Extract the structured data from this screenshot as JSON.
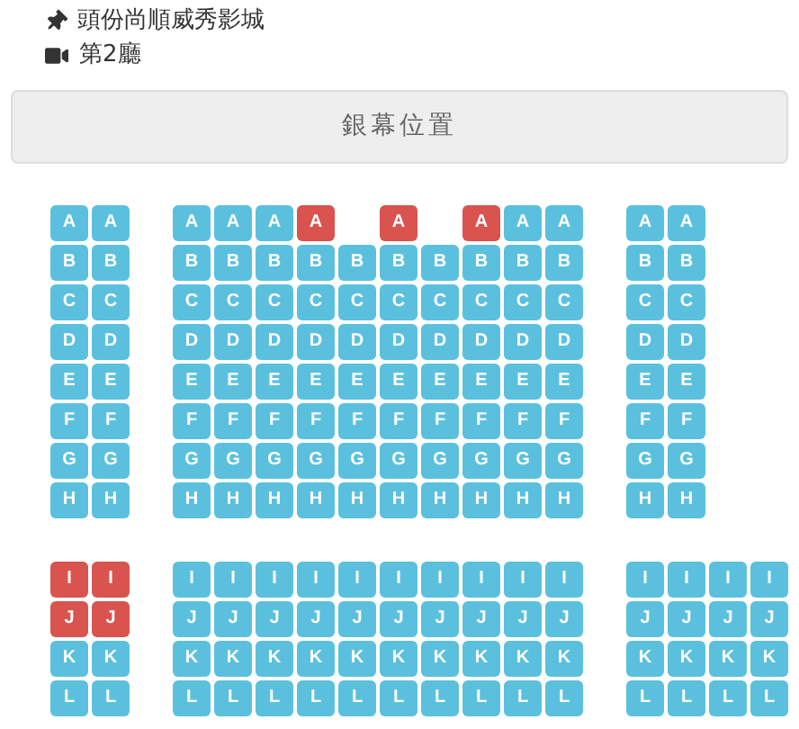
{
  "cinema": "頭份尚順威秀影城",
  "hall": "第2廳",
  "screen": {
    "label": "銀幕位置"
  },
  "sections": [
    {
      "rows": [
        {
          "blocks": [
            [
              {
                "kind": "seat",
                "label": "A",
                "taken": false
              },
              {
                "kind": "seat",
                "label": "A",
                "taken": false
              }
            ],
            [
              {
                "kind": "seat",
                "label": "A",
                "taken": false
              },
              {
                "kind": "seat",
                "label": "A",
                "taken": false
              },
              {
                "kind": "seat",
                "label": "A",
                "taken": false
              },
              {
                "kind": "seat",
                "label": "A",
                "taken": true
              },
              {
                "kind": "empty"
              },
              {
                "kind": "seat",
                "label": "A",
                "taken": true
              },
              {
                "kind": "empty"
              },
              {
                "kind": "seat",
                "label": "A",
                "taken": true
              },
              {
                "kind": "seat",
                "label": "A",
                "taken": false
              },
              {
                "kind": "seat",
                "label": "A",
                "taken": false
              }
            ],
            [
              {
                "kind": "seat",
                "label": "A",
                "taken": false
              },
              {
                "kind": "seat",
                "label": "A",
                "taken": false
              }
            ]
          ]
        },
        {
          "blocks": [
            [
              {
                "kind": "seat",
                "label": "B",
                "taken": false
              },
              {
                "kind": "seat",
                "label": "B",
                "taken": false
              }
            ],
            [
              {
                "kind": "seat",
                "label": "B",
                "taken": false
              },
              {
                "kind": "seat",
                "label": "B",
                "taken": false
              },
              {
                "kind": "seat",
                "label": "B",
                "taken": false
              },
              {
                "kind": "seat",
                "label": "B",
                "taken": false
              },
              {
                "kind": "seat",
                "label": "B",
                "taken": false
              },
              {
                "kind": "seat",
                "label": "B",
                "taken": false
              },
              {
                "kind": "seat",
                "label": "B",
                "taken": false
              },
              {
                "kind": "seat",
                "label": "B",
                "taken": false
              },
              {
                "kind": "seat",
                "label": "B",
                "taken": false
              },
              {
                "kind": "seat",
                "label": "B",
                "taken": false
              }
            ],
            [
              {
                "kind": "seat",
                "label": "B",
                "taken": false
              },
              {
                "kind": "seat",
                "label": "B",
                "taken": false
              }
            ]
          ]
        },
        {
          "blocks": [
            [
              {
                "kind": "seat",
                "label": "C",
                "taken": false
              },
              {
                "kind": "seat",
                "label": "C",
                "taken": false
              }
            ],
            [
              {
                "kind": "seat",
                "label": "C",
                "taken": false
              },
              {
                "kind": "seat",
                "label": "C",
                "taken": false
              },
              {
                "kind": "seat",
                "label": "C",
                "taken": false
              },
              {
                "kind": "seat",
                "label": "C",
                "taken": false
              },
              {
                "kind": "seat",
                "label": "C",
                "taken": false
              },
              {
                "kind": "seat",
                "label": "C",
                "taken": false
              },
              {
                "kind": "seat",
                "label": "C",
                "taken": false
              },
              {
                "kind": "seat",
                "label": "C",
                "taken": false
              },
              {
                "kind": "seat",
                "label": "C",
                "taken": false
              },
              {
                "kind": "seat",
                "label": "C",
                "taken": false
              }
            ],
            [
              {
                "kind": "seat",
                "label": "C",
                "taken": false
              },
              {
                "kind": "seat",
                "label": "C",
                "taken": false
              }
            ]
          ]
        },
        {
          "blocks": [
            [
              {
                "kind": "seat",
                "label": "D",
                "taken": false
              },
              {
                "kind": "seat",
                "label": "D",
                "taken": false
              }
            ],
            [
              {
                "kind": "seat",
                "label": "D",
                "taken": false
              },
              {
                "kind": "seat",
                "label": "D",
                "taken": false
              },
              {
                "kind": "seat",
                "label": "D",
                "taken": false
              },
              {
                "kind": "seat",
                "label": "D",
                "taken": false
              },
              {
                "kind": "seat",
                "label": "D",
                "taken": false
              },
              {
                "kind": "seat",
                "label": "D",
                "taken": false
              },
              {
                "kind": "seat",
                "label": "D",
                "taken": false
              },
              {
                "kind": "seat",
                "label": "D",
                "taken": false
              },
              {
                "kind": "seat",
                "label": "D",
                "taken": false
              },
              {
                "kind": "seat",
                "label": "D",
                "taken": false
              }
            ],
            [
              {
                "kind": "seat",
                "label": "D",
                "taken": false
              },
              {
                "kind": "seat",
                "label": "D",
                "taken": false
              }
            ]
          ]
        },
        {
          "blocks": [
            [
              {
                "kind": "seat",
                "label": "E",
                "taken": false
              },
              {
                "kind": "seat",
                "label": "E",
                "taken": false
              }
            ],
            [
              {
                "kind": "seat",
                "label": "E",
                "taken": false
              },
              {
                "kind": "seat",
                "label": "E",
                "taken": false
              },
              {
                "kind": "seat",
                "label": "E",
                "taken": false
              },
              {
                "kind": "seat",
                "label": "E",
                "taken": false
              },
              {
                "kind": "seat",
                "label": "E",
                "taken": false
              },
              {
                "kind": "seat",
                "label": "E",
                "taken": false
              },
              {
                "kind": "seat",
                "label": "E",
                "taken": false
              },
              {
                "kind": "seat",
                "label": "E",
                "taken": false
              },
              {
                "kind": "seat",
                "label": "E",
                "taken": false
              },
              {
                "kind": "seat",
                "label": "E",
                "taken": false
              }
            ],
            [
              {
                "kind": "seat",
                "label": "E",
                "taken": false
              },
              {
                "kind": "seat",
                "label": "E",
                "taken": false
              }
            ]
          ]
        },
        {
          "blocks": [
            [
              {
                "kind": "seat",
                "label": "F",
                "taken": false
              },
              {
                "kind": "seat",
                "label": "F",
                "taken": false
              }
            ],
            [
              {
                "kind": "seat",
                "label": "F",
                "taken": false
              },
              {
                "kind": "seat",
                "label": "F",
                "taken": false
              },
              {
                "kind": "seat",
                "label": "F",
                "taken": false
              },
              {
                "kind": "seat",
                "label": "F",
                "taken": false
              },
              {
                "kind": "seat",
                "label": "F",
                "taken": false
              },
              {
                "kind": "seat",
                "label": "F",
                "taken": false
              },
              {
                "kind": "seat",
                "label": "F",
                "taken": false
              },
              {
                "kind": "seat",
                "label": "F",
                "taken": false
              },
              {
                "kind": "seat",
                "label": "F",
                "taken": false
              },
              {
                "kind": "seat",
                "label": "F",
                "taken": false
              }
            ],
            [
              {
                "kind": "seat",
                "label": "F",
                "taken": false
              },
              {
                "kind": "seat",
                "label": "F",
                "taken": false
              }
            ]
          ]
        },
        {
          "blocks": [
            [
              {
                "kind": "seat",
                "label": "G",
                "taken": false
              },
              {
                "kind": "seat",
                "label": "G",
                "taken": false
              }
            ],
            [
              {
                "kind": "seat",
                "label": "G",
                "taken": false
              },
              {
                "kind": "seat",
                "label": "G",
                "taken": false
              },
              {
                "kind": "seat",
                "label": "G",
                "taken": false
              },
              {
                "kind": "seat",
                "label": "G",
                "taken": false
              },
              {
                "kind": "seat",
                "label": "G",
                "taken": false
              },
              {
                "kind": "seat",
                "label": "G",
                "taken": false
              },
              {
                "kind": "seat",
                "label": "G",
                "taken": false
              },
              {
                "kind": "seat",
                "label": "G",
                "taken": false
              },
              {
                "kind": "seat",
                "label": "G",
                "taken": false
              },
              {
                "kind": "seat",
                "label": "G",
                "taken": false
              }
            ],
            [
              {
                "kind": "seat",
                "label": "G",
                "taken": false
              },
              {
                "kind": "seat",
                "label": "G",
                "taken": false
              }
            ]
          ]
        },
        {
          "blocks": [
            [
              {
                "kind": "seat",
                "label": "H",
                "taken": false
              },
              {
                "kind": "seat",
                "label": "H",
                "taken": false
              }
            ],
            [
              {
                "kind": "seat",
                "label": "H",
                "taken": false
              },
              {
                "kind": "seat",
                "label": "H",
                "taken": false
              },
              {
                "kind": "seat",
                "label": "H",
                "taken": false
              },
              {
                "kind": "seat",
                "label": "H",
                "taken": false
              },
              {
                "kind": "seat",
                "label": "H",
                "taken": false
              },
              {
                "kind": "seat",
                "label": "H",
                "taken": false
              },
              {
                "kind": "seat",
                "label": "H",
                "taken": false
              },
              {
                "kind": "seat",
                "label": "H",
                "taken": false
              },
              {
                "kind": "seat",
                "label": "H",
                "taken": false
              },
              {
                "kind": "seat",
                "label": "H",
                "taken": false
              }
            ],
            [
              {
                "kind": "seat",
                "label": "H",
                "taken": false
              },
              {
                "kind": "seat",
                "label": "H",
                "taken": false
              }
            ]
          ]
        }
      ]
    },
    {
      "rows": [
        {
          "blocks": [
            [
              {
                "kind": "seat",
                "label": "I",
                "taken": true
              },
              {
                "kind": "seat",
                "label": "I",
                "taken": true
              }
            ],
            [
              {
                "kind": "seat",
                "label": "I",
                "taken": false
              },
              {
                "kind": "seat",
                "label": "I",
                "taken": false
              },
              {
                "kind": "seat",
                "label": "I",
                "taken": false
              },
              {
                "kind": "seat",
                "label": "I",
                "taken": false
              },
              {
                "kind": "seat",
                "label": "I",
                "taken": false
              },
              {
                "kind": "seat",
                "label": "I",
                "taken": false
              },
              {
                "kind": "seat",
                "label": "I",
                "taken": false
              },
              {
                "kind": "seat",
                "label": "I",
                "taken": false
              },
              {
                "kind": "seat",
                "label": "I",
                "taken": false
              },
              {
                "kind": "seat",
                "label": "I",
                "taken": false
              }
            ],
            [
              {
                "kind": "seat",
                "label": "I",
                "taken": false
              },
              {
                "kind": "seat",
                "label": "I",
                "taken": false
              },
              {
                "kind": "seat",
                "label": "I",
                "taken": false
              },
              {
                "kind": "seat",
                "label": "I",
                "taken": false
              }
            ]
          ]
        },
        {
          "blocks": [
            [
              {
                "kind": "seat",
                "label": "J",
                "taken": true
              },
              {
                "kind": "seat",
                "label": "J",
                "taken": true
              }
            ],
            [
              {
                "kind": "seat",
                "label": "J",
                "taken": false
              },
              {
                "kind": "seat",
                "label": "J",
                "taken": false
              },
              {
                "kind": "seat",
                "label": "J",
                "taken": false
              },
              {
                "kind": "seat",
                "label": "J",
                "taken": false
              },
              {
                "kind": "seat",
                "label": "J",
                "taken": false
              },
              {
                "kind": "seat",
                "label": "J",
                "taken": false
              },
              {
                "kind": "seat",
                "label": "J",
                "taken": false
              },
              {
                "kind": "seat",
                "label": "J",
                "taken": false
              },
              {
                "kind": "seat",
                "label": "J",
                "taken": false
              },
              {
                "kind": "seat",
                "label": "J",
                "taken": false
              }
            ],
            [
              {
                "kind": "seat",
                "label": "J",
                "taken": false
              },
              {
                "kind": "seat",
                "label": "J",
                "taken": false
              },
              {
                "kind": "seat",
                "label": "J",
                "taken": false
              },
              {
                "kind": "seat",
                "label": "J",
                "taken": false
              }
            ]
          ]
        },
        {
          "blocks": [
            [
              {
                "kind": "seat",
                "label": "K",
                "taken": false
              },
              {
                "kind": "seat",
                "label": "K",
                "taken": false
              }
            ],
            [
              {
                "kind": "seat",
                "label": "K",
                "taken": false
              },
              {
                "kind": "seat",
                "label": "K",
                "taken": false
              },
              {
                "kind": "seat",
                "label": "K",
                "taken": false
              },
              {
                "kind": "seat",
                "label": "K",
                "taken": false
              },
              {
                "kind": "seat",
                "label": "K",
                "taken": false
              },
              {
                "kind": "seat",
                "label": "K",
                "taken": false
              },
              {
                "kind": "seat",
                "label": "K",
                "taken": false
              },
              {
                "kind": "seat",
                "label": "K",
                "taken": false
              },
              {
                "kind": "seat",
                "label": "K",
                "taken": false
              },
              {
                "kind": "seat",
                "label": "K",
                "taken": false
              }
            ],
            [
              {
                "kind": "seat",
                "label": "K",
                "taken": false
              },
              {
                "kind": "seat",
                "label": "K",
                "taken": false
              },
              {
                "kind": "seat",
                "label": "K",
                "taken": false
              },
              {
                "kind": "seat",
                "label": "K",
                "taken": false
              }
            ]
          ]
        },
        {
          "blocks": [
            [
              {
                "kind": "seat",
                "label": "L",
                "taken": false
              },
              {
                "kind": "seat",
                "label": "L",
                "taken": false
              }
            ],
            [
              {
                "kind": "seat",
                "label": "L",
                "taken": false
              },
              {
                "kind": "seat",
                "label": "L",
                "taken": false
              },
              {
                "kind": "seat",
                "label": "L",
                "taken": false
              },
              {
                "kind": "seat",
                "label": "L",
                "taken": false
              },
              {
                "kind": "seat",
                "label": "L",
                "taken": false
              },
              {
                "kind": "seat",
                "label": "L",
                "taken": false
              },
              {
                "kind": "seat",
                "label": "L",
                "taken": false
              },
              {
                "kind": "seat",
                "label": "L",
                "taken": false
              },
              {
                "kind": "seat",
                "label": "L",
                "taken": false
              },
              {
                "kind": "seat",
                "label": "L",
                "taken": false
              }
            ],
            [
              {
                "kind": "seat",
                "label": "L",
                "taken": false
              },
              {
                "kind": "seat",
                "label": "L",
                "taken": false
              },
              {
                "kind": "seat",
                "label": "L",
                "taken": false
              },
              {
                "kind": "seat",
                "label": "L",
                "taken": false
              }
            ]
          ]
        }
      ]
    }
  ]
}
